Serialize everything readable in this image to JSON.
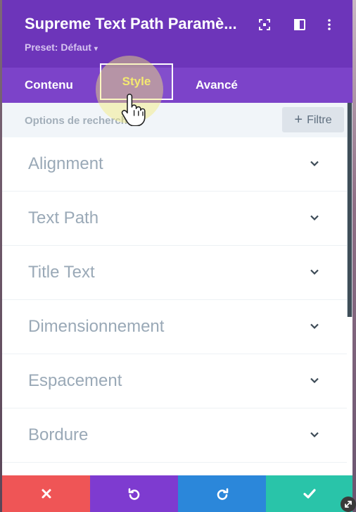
{
  "header": {
    "title": "Supreme Text Path Paramè...",
    "preset_label": "Preset: Défaut",
    "background": "#6d35ba",
    "icons": [
      "expand-icon",
      "columns-icon",
      "more-vertical-icon"
    ]
  },
  "tabs": [
    {
      "label": "Contenu",
      "active": false
    },
    {
      "label": "Style",
      "active": true
    },
    {
      "label": "Avancé",
      "active": false
    }
  ],
  "search": {
    "placeholder": "Options de recherche",
    "filter_label": "Filtre"
  },
  "sections": [
    {
      "label": "Alignment"
    },
    {
      "label": "Text Path"
    },
    {
      "label": "Title Text"
    },
    {
      "label": "Dimensionnement"
    },
    {
      "label": "Espacement"
    },
    {
      "label": "Bordure"
    }
  ],
  "footer": {
    "buttons": [
      {
        "name": "close-icon",
        "color": "#ef5556"
      },
      {
        "name": "undo-icon",
        "color": "#7e3bd0"
      },
      {
        "name": "redo-icon",
        "color": "#2b87da"
      },
      {
        "name": "check-icon",
        "color": "#29c4a9"
      }
    ]
  },
  "colors": {
    "tab_bar": "#7c43c9",
    "active_tab_text": "#f4e76a",
    "section_text": "#9aa9b7"
  }
}
